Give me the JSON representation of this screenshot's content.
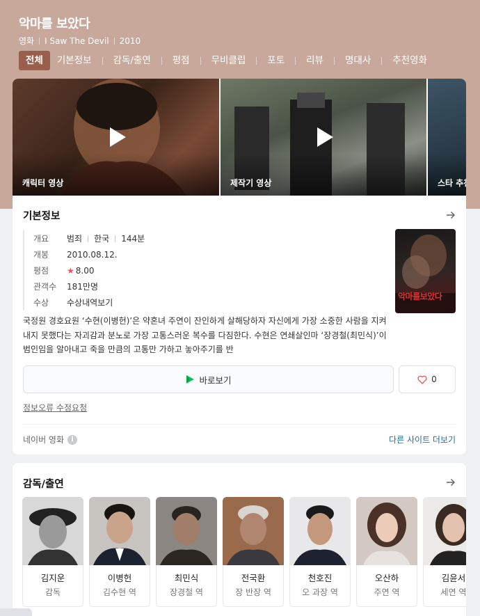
{
  "header": {
    "title": "악마를 보았다",
    "meta": [
      "영화",
      "I Saw The Devil",
      "2010"
    ],
    "tabs": [
      "전체",
      "기본정보",
      "감독/출연",
      "평점",
      "무비클립",
      "포토",
      "리뷰",
      "명대사",
      "추천영화"
    ],
    "active_tab": "전체"
  },
  "videos": [
    {
      "label": "캐릭터 영상",
      "icon": "play-icon"
    },
    {
      "label": "제작기 영상",
      "icon": "play-icon"
    },
    {
      "label": "스타 추천"
    }
  ],
  "basic_info": {
    "title": "기본정보",
    "rows": {
      "overview": {
        "key": "개요",
        "genre": "범죄",
        "country": "한국",
        "runtime": "144분"
      },
      "release": {
        "key": "개봉",
        "value": "2010.08.12."
      },
      "rating": {
        "key": "평점",
        "value": "8.00"
      },
      "audience": {
        "key": "관객수",
        "value": "181만명"
      },
      "awards": {
        "key": "수상",
        "value": "수상내역보기"
      }
    },
    "poster_text": "악마를보았다",
    "synopsis": "국정원 경호요원 ‘수현(이병헌)’은 약혼녀 주연이 잔인하게 살해당하자 자신에게 가장 소중한 사람을 지켜내지 못했다는 자괴감과 분노로 가장 고통스러운 복수를 다짐한다. 수현은 연쇄살인마 ‘장경철(최민식)’이 범인임을 알아내고 죽을 만큼의 고통만 가하고 놓아주기를 반",
    "watch_label": "바로보기",
    "like_count": "0",
    "report_label": "정보오류 수정요청",
    "source_label": "네이버 영화",
    "other_site_label": "다른 사이트 더보기"
  },
  "cast": {
    "title": "감독/출연",
    "people": [
      {
        "name": "김지운",
        "role": "감독"
      },
      {
        "name": "이병헌",
        "role": "김수현 역"
      },
      {
        "name": "최민식",
        "role": "장경철 역"
      },
      {
        "name": "전국환",
        "role": "장 반장 역"
      },
      {
        "name": "천호진",
        "role": "오 과장 역"
      },
      {
        "name": "오산하",
        "role": "주연 역"
      },
      {
        "name": "김윤서",
        "role": "세연 역"
      }
    ]
  },
  "colors": {
    "header_bg": "#c9a89c",
    "active_tab": "#9a5e4c",
    "link": "#246fa8",
    "star": "#f0505a"
  }
}
